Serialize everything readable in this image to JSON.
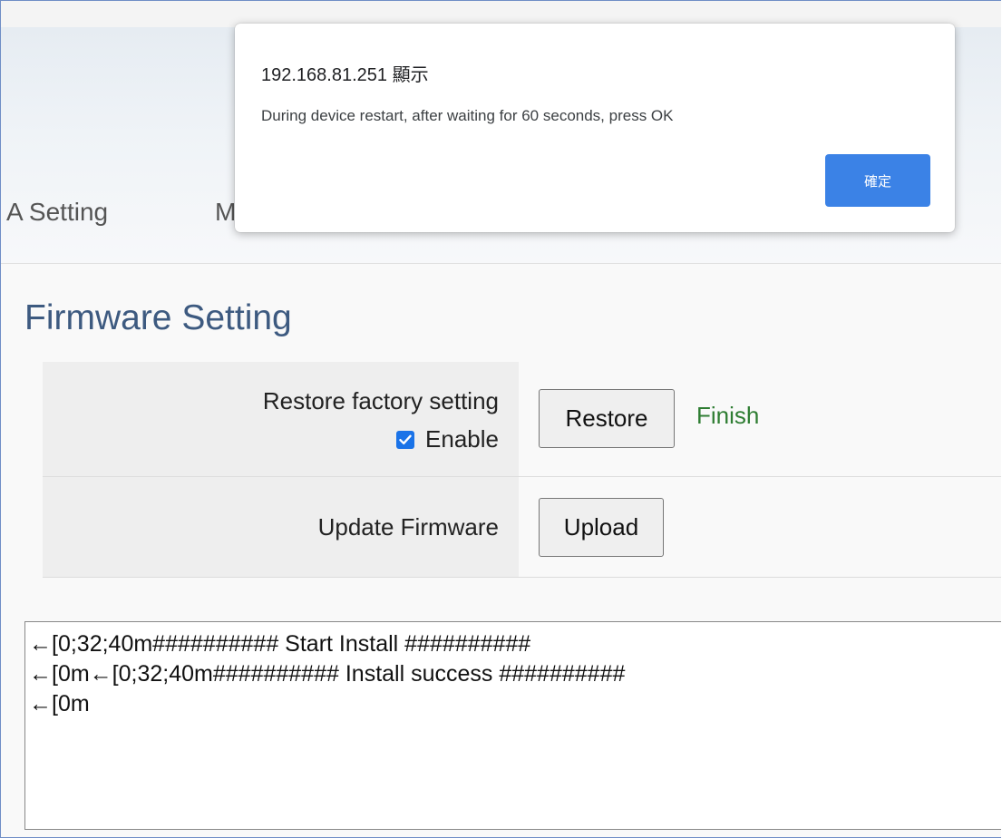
{
  "nav": {
    "items": [
      {
        "label": "A Setting"
      },
      {
        "label": "M"
      }
    ]
  },
  "page": {
    "title": "Firmware Setting"
  },
  "settings": {
    "restore": {
      "label": "Restore factory setting",
      "checkbox_label": "Enable",
      "checked": true,
      "button": "Restore",
      "status": "Finish"
    },
    "update": {
      "label": "Update Firmware",
      "button": "Upload"
    }
  },
  "log": {
    "lines": [
      "←[0;32;40m########## Start Install ##########",
      "←[0m←[0;32;40m########## Install success ##########",
      "←[0m"
    ]
  },
  "dialog": {
    "title": "192.168.81.251 顯示",
    "message": "During device restart, after waiting for 60 seconds, press OK",
    "ok_button": "確定"
  },
  "colors": {
    "title_blue": "#3d5a80",
    "status_green": "#2e7d32",
    "checkbox_blue": "#1a73e8",
    "dialog_button_blue": "#3b82e6"
  },
  "icons": {
    "checkbox": "checkmark-icon"
  }
}
